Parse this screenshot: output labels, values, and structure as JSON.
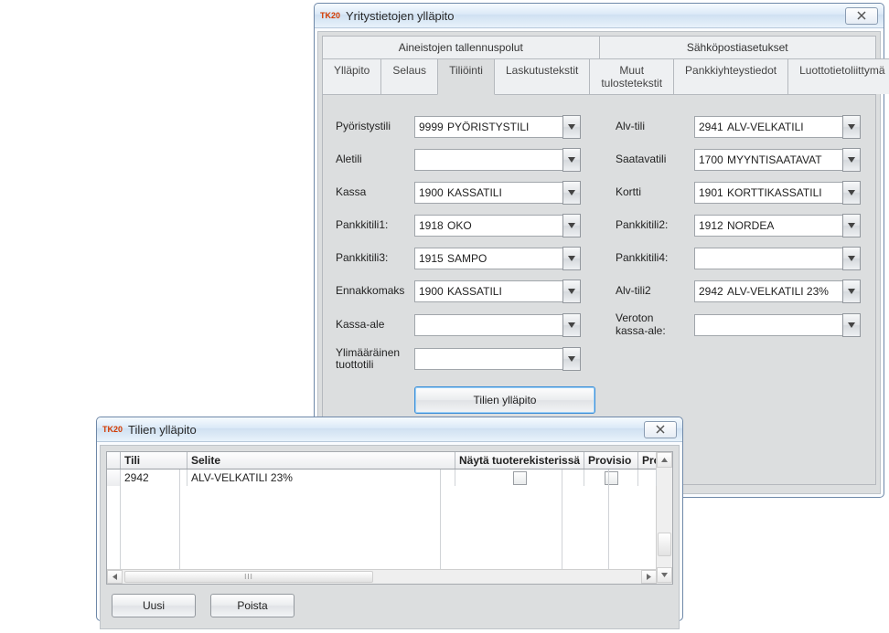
{
  "app_icon_text": "TK20",
  "top_window": {
    "title": "Yritystietojen ylläpito",
    "big_tabs": [
      "Aineistojen tallennuspolut",
      "Sähköpostiasetukset"
    ],
    "sub_tabs": [
      "Ylläpito",
      "Selaus",
      "Tiliöinti",
      "Laskutustekstit",
      "Muut tulostetekstit",
      "Pankkiyhteystiedot",
      "Luottotietoliittymä"
    ],
    "active_sub_tab": "Tiliöinti",
    "rows": [
      {
        "l_label": "Pyöristystili",
        "l_code": "9999",
        "l_text": "PYÖRISTYSTILI",
        "r_label": "Alv-tili",
        "r_code": "2941",
        "r_text": "ALV-VELKATILI"
      },
      {
        "l_label": "Aletili",
        "l_code": "",
        "l_text": "",
        "r_label": "Saatavatili",
        "r_code": "1700",
        "r_text": "MYYNTISAATAVAT"
      },
      {
        "l_label": "Kassa",
        "l_code": "1900",
        "l_text": "KASSATILI",
        "r_label": "Kortti",
        "r_code": "1901",
        "r_text": "KORTTIKASSATILI"
      },
      {
        "l_label": "Pankkitili1:",
        "l_code": "1918",
        "l_text": "OKO",
        "r_label": "Pankkitili2:",
        "r_code": "1912",
        "r_text": "NORDEA"
      },
      {
        "l_label": "Pankkitili3:",
        "l_code": "1915",
        "l_text": "SAMPO",
        "r_label": "Pankkitili4:",
        "r_code": "",
        "r_text": ""
      },
      {
        "l_label": "Ennakkomaks",
        "l_code": "1900",
        "l_text": "KASSATILI",
        "r_label": "Alv-tili2",
        "r_code": "2942",
        "r_text": "ALV-VELKATILI 23%"
      },
      {
        "l_label": "Kassa-ale",
        "l_code": "",
        "l_text": "",
        "r_label": "Veroton\nkassa-ale:",
        "r_code": "",
        "r_text": ""
      },
      {
        "l_label": "Ylimääräinen\ntuottotili",
        "l_code": "",
        "l_text": "",
        "r_label": "",
        "r_code": "",
        "r_text": ""
      }
    ],
    "accounts_button": "Tilien ylläpito"
  },
  "accounts_window": {
    "title": "Tilien ylläpito",
    "columns": [
      "Tili",
      "Selite",
      "Näytä tuoterekisterissä",
      "Provisio",
      "Provisio"
    ],
    "row": {
      "tili": "2942",
      "selite": "ALV-VELKATILI 23%"
    },
    "buttons": {
      "new": "Uusi",
      "delete": "Poista"
    }
  }
}
